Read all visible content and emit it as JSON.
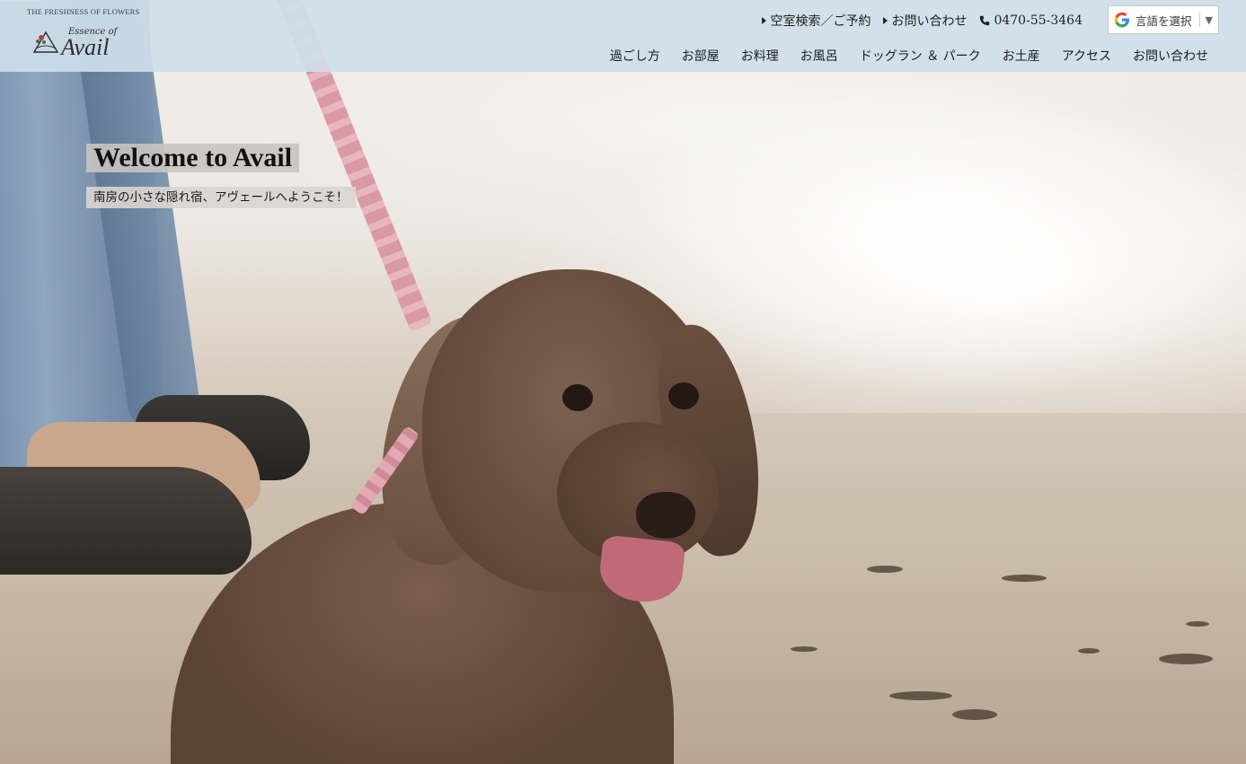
{
  "logo": {
    "tagline": "THE FRESHNESS OF FLOWERS",
    "essence": "Essence of",
    "name": "Avail"
  },
  "utility_links": [
    {
      "label": "空室検索／ご予約",
      "icon": "triangle-right-icon"
    },
    {
      "label": "お問い合わせ",
      "icon": "triangle-right-icon"
    },
    {
      "label": "0470-55-3464",
      "icon": "phone-icon"
    }
  ],
  "translate": {
    "label": "言語を選択",
    "arrow": "▼",
    "icon": "google-g-icon"
  },
  "nav": {
    "items": [
      "過ごし方",
      "お部屋",
      "お料理",
      "お風呂",
      "ドッグラン ＆ パーク",
      "お土産",
      "アクセス",
      "お問い合わせ"
    ]
  },
  "hero": {
    "title": "Welcome to Avail",
    "subtitle": "南房の小さな隠れ宿、アヴェールへようこそ！"
  },
  "colors": {
    "header_bg": "#cedeea",
    "text": "#1d1d1d"
  }
}
